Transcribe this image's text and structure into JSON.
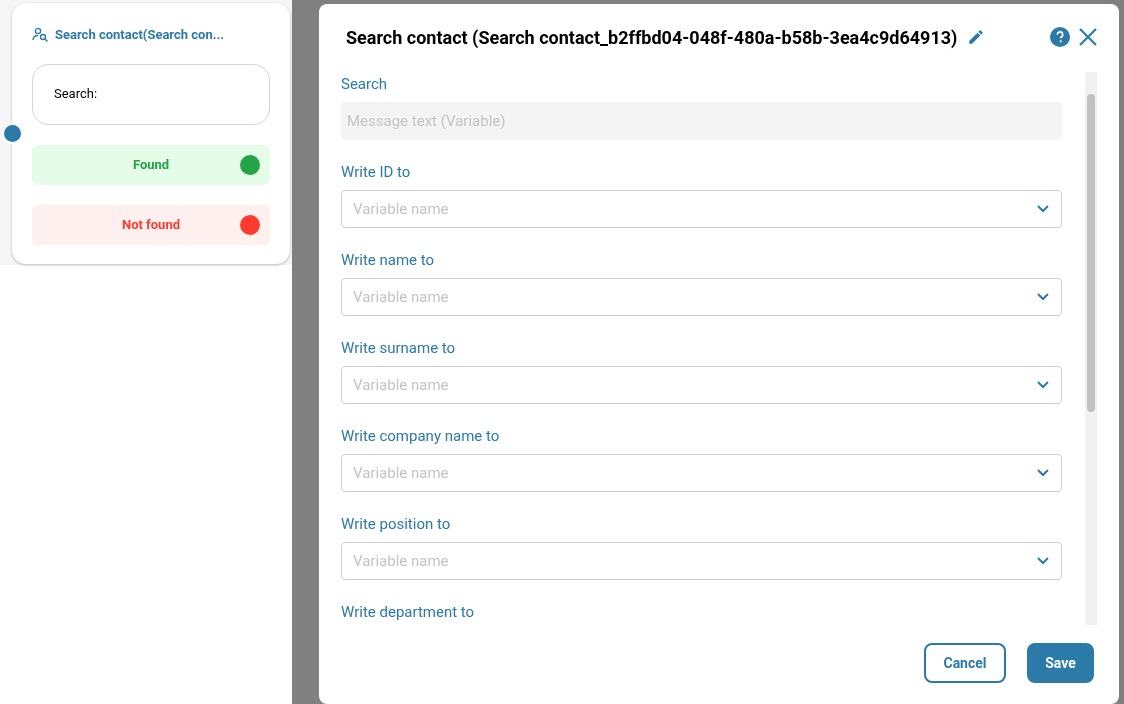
{
  "node": {
    "title": "Search contact(Search con...",
    "search_label": "Search:",
    "outcomes": [
      {
        "label": "Found",
        "kind": "success",
        "color": "#24a347"
      },
      {
        "label": "Not found",
        "kind": "failure",
        "color": "#ff3b30"
      }
    ]
  },
  "dialog": {
    "title": "Search contact (Search contact_b2ffbd04-048f-480a-b58b-3ea4c9d64913)",
    "fields": [
      {
        "label": "Search",
        "kind": "readonly",
        "placeholder": "Message text (Variable)"
      },
      {
        "label": "Write ID to",
        "kind": "select",
        "placeholder": "Variable name"
      },
      {
        "label": "Write name to",
        "kind": "select",
        "placeholder": "Variable name"
      },
      {
        "label": "Write surname to",
        "kind": "select",
        "placeholder": "Variable name"
      },
      {
        "label": "Write company name to",
        "kind": "select",
        "placeholder": "Variable name"
      },
      {
        "label": "Write position to",
        "kind": "select",
        "placeholder": "Variable name"
      },
      {
        "label": "Write department to",
        "kind": "label"
      }
    ],
    "buttons": [
      {
        "label": "Cancel",
        "kind": "secondary"
      },
      {
        "label": "Save",
        "kind": "primary"
      }
    ]
  }
}
